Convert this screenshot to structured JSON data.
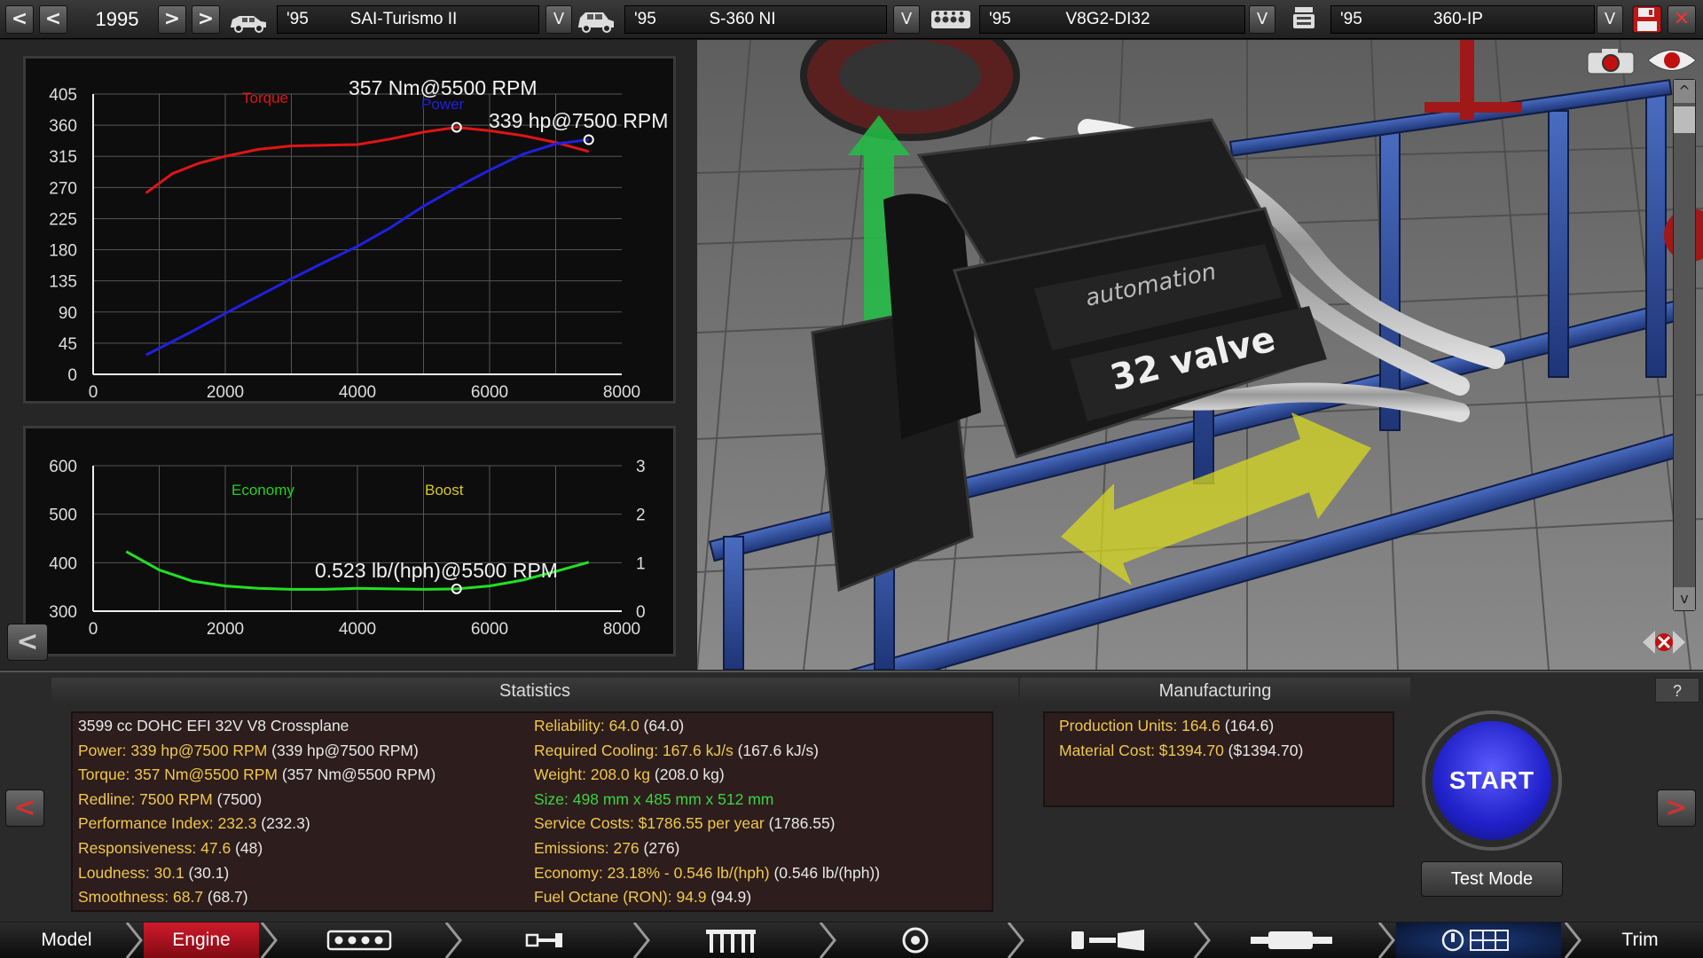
{
  "topbar": {
    "year": "1995",
    "car": {
      "year": "'95",
      "name": "SAI-Turismo II"
    },
    "trim": {
      "year": "'95",
      "name": "S-360 NI"
    },
    "engine": {
      "year": "'95",
      "name": "V8G2-DI32"
    },
    "variant": {
      "year": "'95",
      "name": "360-IP"
    },
    "prev_label": "<",
    "next_label": ">",
    "dropdown_label": "V",
    "close_label": "✕"
  },
  "chart_data": [
    {
      "type": "line",
      "xlim": [
        0,
        8000
      ],
      "ylim": [
        0,
        405
      ],
      "x_ticks": [
        "0",
        "2000",
        "4000",
        "6000",
        "8000"
      ],
      "y_ticks": [
        "405",
        "360",
        "315",
        "270",
        "225",
        "180",
        "135",
        "90",
        "45",
        "0"
      ],
      "series": [
        {
          "name": "Torque",
          "color": "#e01515",
          "x": [
            800,
            1200,
            1600,
            2000,
            2500,
            3000,
            3500,
            4000,
            4500,
            5000,
            5500,
            6000,
            6500,
            7000,
            7500
          ],
          "y": [
            262,
            290,
            305,
            315,
            325,
            330,
            331,
            332,
            340,
            350,
            357,
            352,
            345,
            335,
            322
          ]
        },
        {
          "name": "Power",
          "color": "#2020e0",
          "x": [
            800,
            1500,
            2000,
            2500,
            3000,
            3500,
            4000,
            4500,
            5000,
            5500,
            6000,
            6500,
            7000,
            7500
          ],
          "y": [
            28,
            62,
            88,
            113,
            138,
            162,
            185,
            212,
            243,
            270,
            295,
            318,
            333,
            339
          ]
        }
      ],
      "annotations": [
        "357 Nm@5500 RPM",
        "339 hp@7500 RPM"
      ],
      "torque_label": "Torque",
      "power_label": "Power"
    },
    {
      "type": "line",
      "xlim": [
        0,
        8000
      ],
      "ylim": [
        300,
        600
      ],
      "y2lim": [
        0,
        3
      ],
      "x_ticks": [
        "0",
        "2000",
        "4000",
        "6000",
        "8000"
      ],
      "y_ticks": [
        "600",
        "500",
        "400",
        "300"
      ],
      "y2_ticks": [
        "3",
        "2",
        "1",
        "0"
      ],
      "series": [
        {
          "name": "Economy",
          "color": "#22e022",
          "x": [
            500,
            1000,
            1500,
            2000,
            2500,
            3000,
            3500,
            4000,
            4500,
            5000,
            5500,
            6000,
            6500,
            7000,
            7500
          ],
          "y": [
            423,
            385,
            362,
            352,
            347,
            345,
            345,
            347,
            346,
            345,
            346,
            352,
            364,
            382,
            401
          ]
        }
      ],
      "annotations": [
        "0.523 lb/(hph)@5500 RPM"
      ],
      "economy_label": "Economy",
      "boost_label": "Boost"
    }
  ],
  "statistics": {
    "title": "Statistics",
    "left": [
      {
        "text": "3599 cc DOHC EFI 32V V8 Crossplane",
        "paren": ""
      },
      {
        "text": "Power: 339 hp@7500 RPM",
        "paren": "(339 hp@7500 RPM)"
      },
      {
        "text": "Torque: 357 Nm@5500 RPM",
        "paren": "(357 Nm@5500 RPM)"
      },
      {
        "text": "Redline: 7500 RPM",
        "paren": "(7500)"
      },
      {
        "text": "Performance Index: 232.3",
        "paren": "(232.3)"
      },
      {
        "text": "Responsiveness: 47.6",
        "paren": "(48)"
      },
      {
        "text": "Loudness: 30.1",
        "paren": "(30.1)"
      },
      {
        "text": "Smoothness: 68.7",
        "paren": "(68.7)"
      }
    ],
    "right": [
      {
        "text": "Reliability: 64.0",
        "paren": "(64.0)"
      },
      {
        "text": "Required Cooling: 167.6 kJ/s",
        "paren": "(167.6 kJ/s)"
      },
      {
        "text": "Weight: 208.0 kg",
        "paren": "(208.0 kg)"
      },
      {
        "text": "Size: 498 mm x 485 mm x 512 mm",
        "paren": ""
      },
      {
        "text": "Service Costs: $1786.55 per year",
        "paren": "(1786.55)"
      },
      {
        "text": "Emissions: 276",
        "paren": "(276)"
      },
      {
        "text": "Economy: 23.18% - 0.546 lb/(hph)",
        "paren": "(0.546 lb/(hph))"
      },
      {
        "text": "Fuel Octane (RON): 94.9",
        "paren": "(94.9)"
      }
    ]
  },
  "manufacturing": {
    "title": "Manufacturing",
    "lines": [
      {
        "text": "Production Units: 164.6",
        "paren": "(164.6)"
      },
      {
        "text": "Material Cost: $1394.70",
        "paren": "($1394.70)"
      }
    ]
  },
  "buttons": {
    "start": "START",
    "test_mode": "Test Mode",
    "help": "?",
    "back": "<",
    "forward": ">"
  },
  "engine_decals": {
    "brand": "automation",
    "valve": "32 valve"
  },
  "nav": {
    "model": "Model",
    "engine": "Engine",
    "trim": "Trim"
  },
  "colors": {
    "torque": "#e01515",
    "power": "#2020e0",
    "economy": "#22e022",
    "stat_text": "#f0c84a",
    "size_text": "#3ed23e",
    "start": "#2a2ae0",
    "nav_active": "#c01020"
  }
}
